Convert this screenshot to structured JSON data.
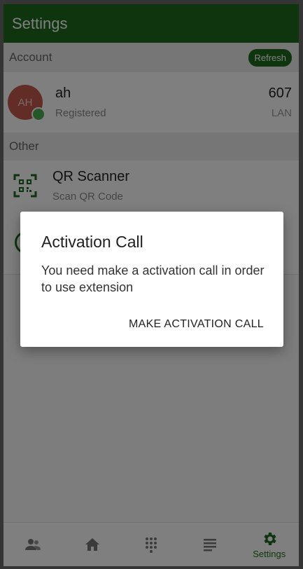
{
  "appbar": {
    "title": "Settings"
  },
  "account_section": {
    "header": "Account",
    "refresh_label": "Refresh",
    "account": {
      "avatar_initials": "AH",
      "name": "ah",
      "status": "Registered",
      "extension": "607",
      "transport": "LAN",
      "status_color": "#4caf50"
    }
  },
  "other_section": {
    "header": "Other",
    "items": [
      {
        "title": "QR Scanner",
        "subtitle": "Scan QR Code",
        "icon": "qr-code-icon"
      }
    ]
  },
  "dialog": {
    "title": "Activation Call",
    "message": "You need make a activation call in order to use extension",
    "action_label": "MAKE ACTIVATION CALL"
  },
  "bottom_nav": {
    "items": [
      {
        "icon": "contacts-icon",
        "label": ""
      },
      {
        "icon": "home-icon",
        "label": ""
      },
      {
        "icon": "dialpad-icon",
        "label": ""
      },
      {
        "icon": "list-icon",
        "label": ""
      },
      {
        "icon": "settings-gear-icon",
        "label": "Settings",
        "active": true
      }
    ]
  },
  "colors": {
    "brand_green": "#1f6b1f",
    "avatar_bg": "#c35a4c",
    "scrim": "rgba(0,0,0,0.5)"
  }
}
